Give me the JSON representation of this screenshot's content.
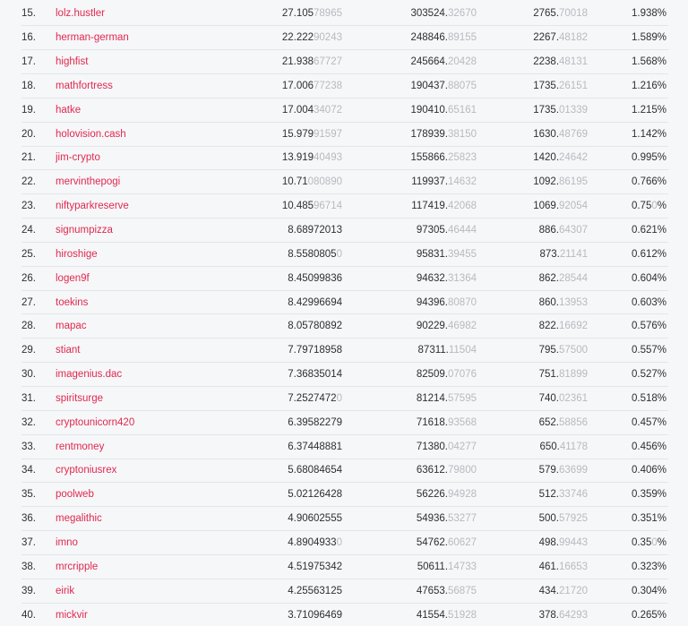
{
  "rows": [
    {
      "rank": "15.",
      "account": "lolz.hustler",
      "v1": [
        "27.105",
        "78965"
      ],
      "v2": [
        "303524.",
        "32670"
      ],
      "v3": [
        "2765.",
        "70018"
      ],
      "pct": [
        "1.938%",
        ""
      ]
    },
    {
      "rank": "16.",
      "account": "herman-german",
      "v1": [
        "22.222",
        "90243"
      ],
      "v2": [
        "248846.",
        "89155"
      ],
      "v3": [
        "2267.",
        "48182"
      ],
      "pct": [
        "1.589%",
        ""
      ]
    },
    {
      "rank": "17.",
      "account": "highfist",
      "v1": [
        "21.938",
        "67727"
      ],
      "v2": [
        "245664.",
        "20428"
      ],
      "v3": [
        "2238.",
        "48131"
      ],
      "pct": [
        "1.568%",
        ""
      ]
    },
    {
      "rank": "18.",
      "account": "mathfortress",
      "v1": [
        "17.006",
        "77238"
      ],
      "v2": [
        "190437.",
        "88075"
      ],
      "v3": [
        "1735.",
        "26151"
      ],
      "pct": [
        "1.216%",
        ""
      ]
    },
    {
      "rank": "19.",
      "account": "hatke",
      "v1": [
        "17.004",
        "34072"
      ],
      "v2": [
        "190410.",
        "65161"
      ],
      "v3": [
        "1735.",
        "01339"
      ],
      "pct": [
        "1.215%",
        ""
      ]
    },
    {
      "rank": "20.",
      "account": "holovision.cash",
      "v1": [
        "15.979",
        "91597"
      ],
      "v2": [
        "178939.",
        "38150"
      ],
      "v3": [
        "1630.",
        "48769"
      ],
      "pct": [
        "1.142%",
        ""
      ]
    },
    {
      "rank": "21.",
      "account": "jim-crypto",
      "v1": [
        "13.919",
        "40493"
      ],
      "v2": [
        "155866.",
        "25823"
      ],
      "v3": [
        "1420.",
        "24642"
      ],
      "pct": [
        "0.995%",
        ""
      ]
    },
    {
      "rank": "22.",
      "account": "mervinthepogi",
      "v1": [
        "10.71",
        "080890"
      ],
      "v2": [
        "119937.",
        "14632"
      ],
      "v3": [
        "1092.",
        "86195"
      ],
      "pct": [
        "0.766%",
        ""
      ]
    },
    {
      "rank": "23.",
      "account": "niftyparkreserve",
      "v1": [
        "10.485",
        "96714"
      ],
      "v2": [
        "117419.",
        "42068"
      ],
      "v3": [
        "1069.",
        "92054"
      ],
      "pct": [
        "0.75",
        "0",
        "%"
      ]
    },
    {
      "rank": "24.",
      "account": "signumpizza",
      "v1": [
        "8.68972013",
        ""
      ],
      "v2": [
        "97305.",
        "46444"
      ],
      "v3": [
        "886.",
        "64307"
      ],
      "pct": [
        "0.621%",
        ""
      ]
    },
    {
      "rank": "25.",
      "account": "hiroshige",
      "v1": [
        "8.5580805",
        "0"
      ],
      "v2": [
        "95831.",
        "39455"
      ],
      "v3": [
        "873.",
        "21141"
      ],
      "pct": [
        "0.612%",
        ""
      ]
    },
    {
      "rank": "26.",
      "account": "logen9f",
      "v1": [
        "8.45099836",
        ""
      ],
      "v2": [
        "94632.",
        "31364"
      ],
      "v3": [
        "862.",
        "28544"
      ],
      "pct": [
        "0.604%",
        ""
      ]
    },
    {
      "rank": "27.",
      "account": "toekins",
      "v1": [
        "8.42996694",
        ""
      ],
      "v2": [
        "94396.",
        "80870"
      ],
      "v3": [
        "860.",
        "13953"
      ],
      "pct": [
        "0.603%",
        ""
      ]
    },
    {
      "rank": "28.",
      "account": "mapac",
      "v1": [
        "8.05780892",
        ""
      ],
      "v2": [
        "90229.",
        "46982"
      ],
      "v3": [
        "822.",
        "16692"
      ],
      "pct": [
        "0.576%",
        ""
      ]
    },
    {
      "rank": "29.",
      "account": "stiant",
      "v1": [
        "7.79718958",
        ""
      ],
      "v2": [
        "87311.",
        "11504"
      ],
      "v3": [
        "795.",
        "57500"
      ],
      "pct": [
        "0.557%",
        ""
      ]
    },
    {
      "rank": "30.",
      "account": "imagenius.dac",
      "v1": [
        "7.36835014",
        ""
      ],
      "v2": [
        "82509.",
        "07076"
      ],
      "v3": [
        "751.",
        "81899"
      ],
      "pct": [
        "0.527%",
        ""
      ]
    },
    {
      "rank": "31.",
      "account": "spiritsurge",
      "v1": [
        "7.2527472",
        "0"
      ],
      "v2": [
        "81214.",
        "57595"
      ],
      "v3": [
        "740.",
        "02361"
      ],
      "pct": [
        "0.518%",
        ""
      ]
    },
    {
      "rank": "32.",
      "account": "cryptounicorn420",
      "v1": [
        "6.39582279",
        ""
      ],
      "v2": [
        "71618.",
        "93568"
      ],
      "v3": [
        "652.",
        "58856"
      ],
      "pct": [
        "0.457%",
        ""
      ]
    },
    {
      "rank": "33.",
      "account": "rentmoney",
      "v1": [
        "6.37448881",
        ""
      ],
      "v2": [
        "71380.",
        "04277"
      ],
      "v3": [
        "650.",
        "41178"
      ],
      "pct": [
        "0.456%",
        ""
      ]
    },
    {
      "rank": "34.",
      "account": "cryptoniusrex",
      "v1": [
        "5.68084654",
        ""
      ],
      "v2": [
        "63612.",
        "79800"
      ],
      "v3": [
        "579.",
        "63699"
      ],
      "pct": [
        "0.406%",
        ""
      ]
    },
    {
      "rank": "35.",
      "account": "poolweb",
      "v1": [
        "5.02126428",
        ""
      ],
      "v2": [
        "56226.",
        "94928"
      ],
      "v3": [
        "512.",
        "33746"
      ],
      "pct": [
        "0.359%",
        ""
      ]
    },
    {
      "rank": "36.",
      "account": "megalithic",
      "v1": [
        "4.90602555",
        ""
      ],
      "v2": [
        "54936.",
        "53277"
      ],
      "v3": [
        "500.",
        "57925"
      ],
      "pct": [
        "0.351%",
        ""
      ]
    },
    {
      "rank": "37.",
      "account": "imno",
      "v1": [
        "4.8904933",
        "0"
      ],
      "v2": [
        "54762.",
        "60627"
      ],
      "v3": [
        "498.",
        "99443"
      ],
      "pct": [
        "0.35",
        "0",
        "%"
      ]
    },
    {
      "rank": "38.",
      "account": "mrcripple",
      "v1": [
        "4.51975342",
        ""
      ],
      "v2": [
        "50611.",
        "14733"
      ],
      "v3": [
        "461.",
        "16653"
      ],
      "pct": [
        "0.323%",
        ""
      ]
    },
    {
      "rank": "39.",
      "account": "eirik",
      "v1": [
        "4.25563125",
        ""
      ],
      "v2": [
        "47653.",
        "56875"
      ],
      "v3": [
        "434.",
        "21720"
      ],
      "pct": [
        "0.304%",
        ""
      ]
    },
    {
      "rank": "40.",
      "account": "mickvir",
      "v1": [
        "3.71096469",
        ""
      ],
      "v2": [
        "41554.",
        "51928"
      ],
      "v3": [
        "378.",
        "64293"
      ],
      "pct": [
        "0.265%",
        ""
      ]
    }
  ],
  "colors": {
    "account_link": "#e0294f",
    "text": "#2d2f33",
    "dim_digits": "#b7babf",
    "row_border": "#e3e5e8",
    "background": "#f6f7f9"
  }
}
